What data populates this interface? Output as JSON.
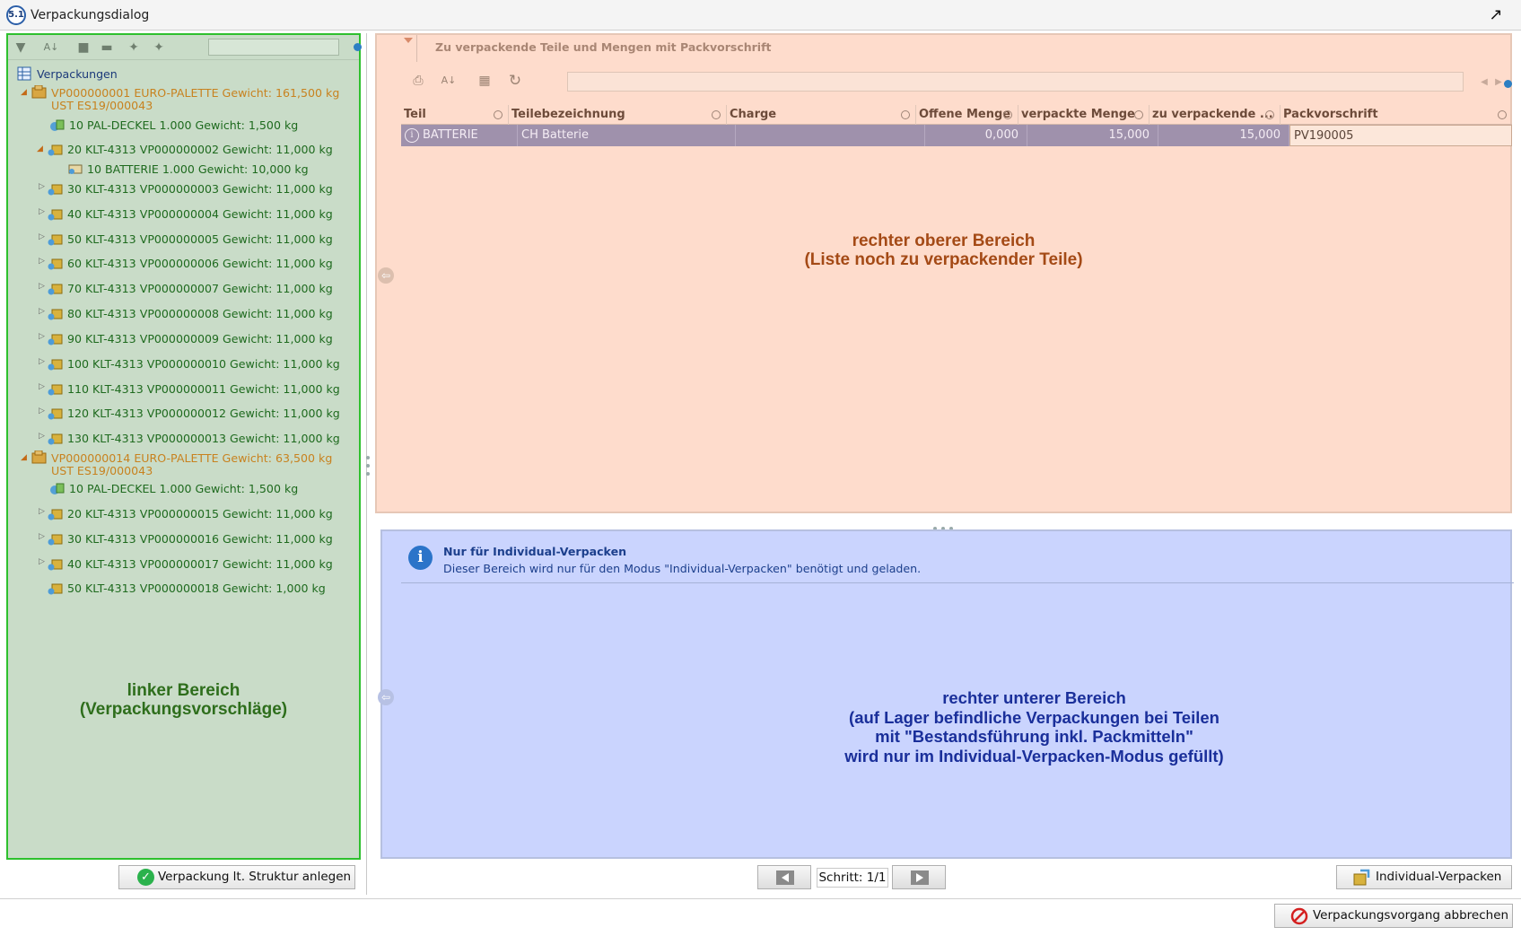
{
  "window": {
    "app_badge": "5.1",
    "title": "Verpackungsdialog"
  },
  "left": {
    "search_value": "",
    "tree_root": "Verpackungen",
    "nodes": [
      {
        "label": "VP000000001 EURO-PALETTE Gewicht: 161,500 kg",
        "label2": "UST ES19/000043"
      },
      {
        "label": "10 PAL-DECKEL 1.000 Gewicht: 1,500 kg"
      },
      {
        "label": "20 KLT-4313 VP000000002 Gewicht: 11,000 kg"
      },
      {
        "label": "10 BATTERIE 1.000 Gewicht: 10,000 kg"
      },
      {
        "label": "30 KLT-4313 VP000000003 Gewicht: 11,000 kg"
      },
      {
        "label": "40 KLT-4313 VP000000004 Gewicht: 11,000 kg"
      },
      {
        "label": "50 KLT-4313 VP000000005 Gewicht: 11,000 kg"
      },
      {
        "label": "60 KLT-4313 VP000000006 Gewicht: 11,000 kg"
      },
      {
        "label": "70 KLT-4313 VP000000007 Gewicht: 11,000 kg"
      },
      {
        "label": "80 KLT-4313 VP000000008 Gewicht: 11,000 kg"
      },
      {
        "label": "90 KLT-4313 VP000000009 Gewicht: 11,000 kg"
      },
      {
        "label": "100 KLT-4313 VP000000010 Gewicht: 11,000 kg"
      },
      {
        "label": "110 KLT-4313 VP000000011 Gewicht: 11,000 kg"
      },
      {
        "label": "120 KLT-4313 VP000000012 Gewicht: 11,000 kg"
      },
      {
        "label": "130 KLT-4313 VP000000013 Gewicht: 11,000 kg"
      },
      {
        "label": "VP000000014 EURO-PALETTE Gewicht: 63,500 kg",
        "label2": "UST ES19/000043"
      },
      {
        "label": "10 PAL-DECKEL 1.000 Gewicht: 1,500 kg"
      },
      {
        "label": "20 KLT-4313 VP000000015 Gewicht: 11,000 kg"
      },
      {
        "label": "30 KLT-4313 VP000000016 Gewicht: 11,000 kg"
      },
      {
        "label": "40 KLT-4313 VP000000017 Gewicht: 11,000 kg"
      },
      {
        "label": "50 KLT-4313 VP000000018 Gewicht: 1,000 kg"
      }
    ],
    "caption_line1": "linker Bereich",
    "caption_line2": "(Verpackungsvorschläge)",
    "create_button": "Verpackung lt. Struktur anlegen"
  },
  "right_top": {
    "header": "Zu verpackende Teile und Mengen mit Packvorschrift",
    "search_value": "",
    "columns": [
      "Teil",
      "Teilebezeichnung",
      "Charge",
      "Offene Menge",
      "verpackte Menge",
      "zu verpackende ...",
      "Packvorschrift"
    ],
    "rows": [
      {
        "teil": "BATTERIE",
        "bezeichnung": "CH Batterie",
        "charge": "",
        "offen": "0,000",
        "verpackt": "15,000",
        "zu_verpacken": "15,000",
        "packvorschrift": "PV190005"
      }
    ],
    "caption_line1": "rechter oberer Bereich",
    "caption_line2": "(Liste noch zu verpackender Teile)"
  },
  "right_bottom": {
    "info_title": "Nur für Individual-Verpacken",
    "info_text": "Dieser Bereich wird nur für den Modus \"Individual-Verpacken\" benötigt und geladen.",
    "caption_line1": "rechter unterer Bereich",
    "caption_line2": "(auf Lager befindliche Verpackungen bei Teilen",
    "caption_line3": "mit \"Bestandsführung inkl. Packmitteln\"",
    "caption_line4": "wird nur im Individual-Verpacken-Modus gefüllt)"
  },
  "footer": {
    "step_label": "Schritt: 1/1",
    "individual_button": "Individual-Verpacken",
    "cancel_button": "Verpackungsvorgang abbrechen"
  },
  "colors": {
    "left_bg": "#c9dcc8",
    "left_border": "#2ec02e",
    "right_top_bg": "#fedccc",
    "right_bottom_bg": "#cad4fe",
    "selected_row": "#9f91ac"
  }
}
